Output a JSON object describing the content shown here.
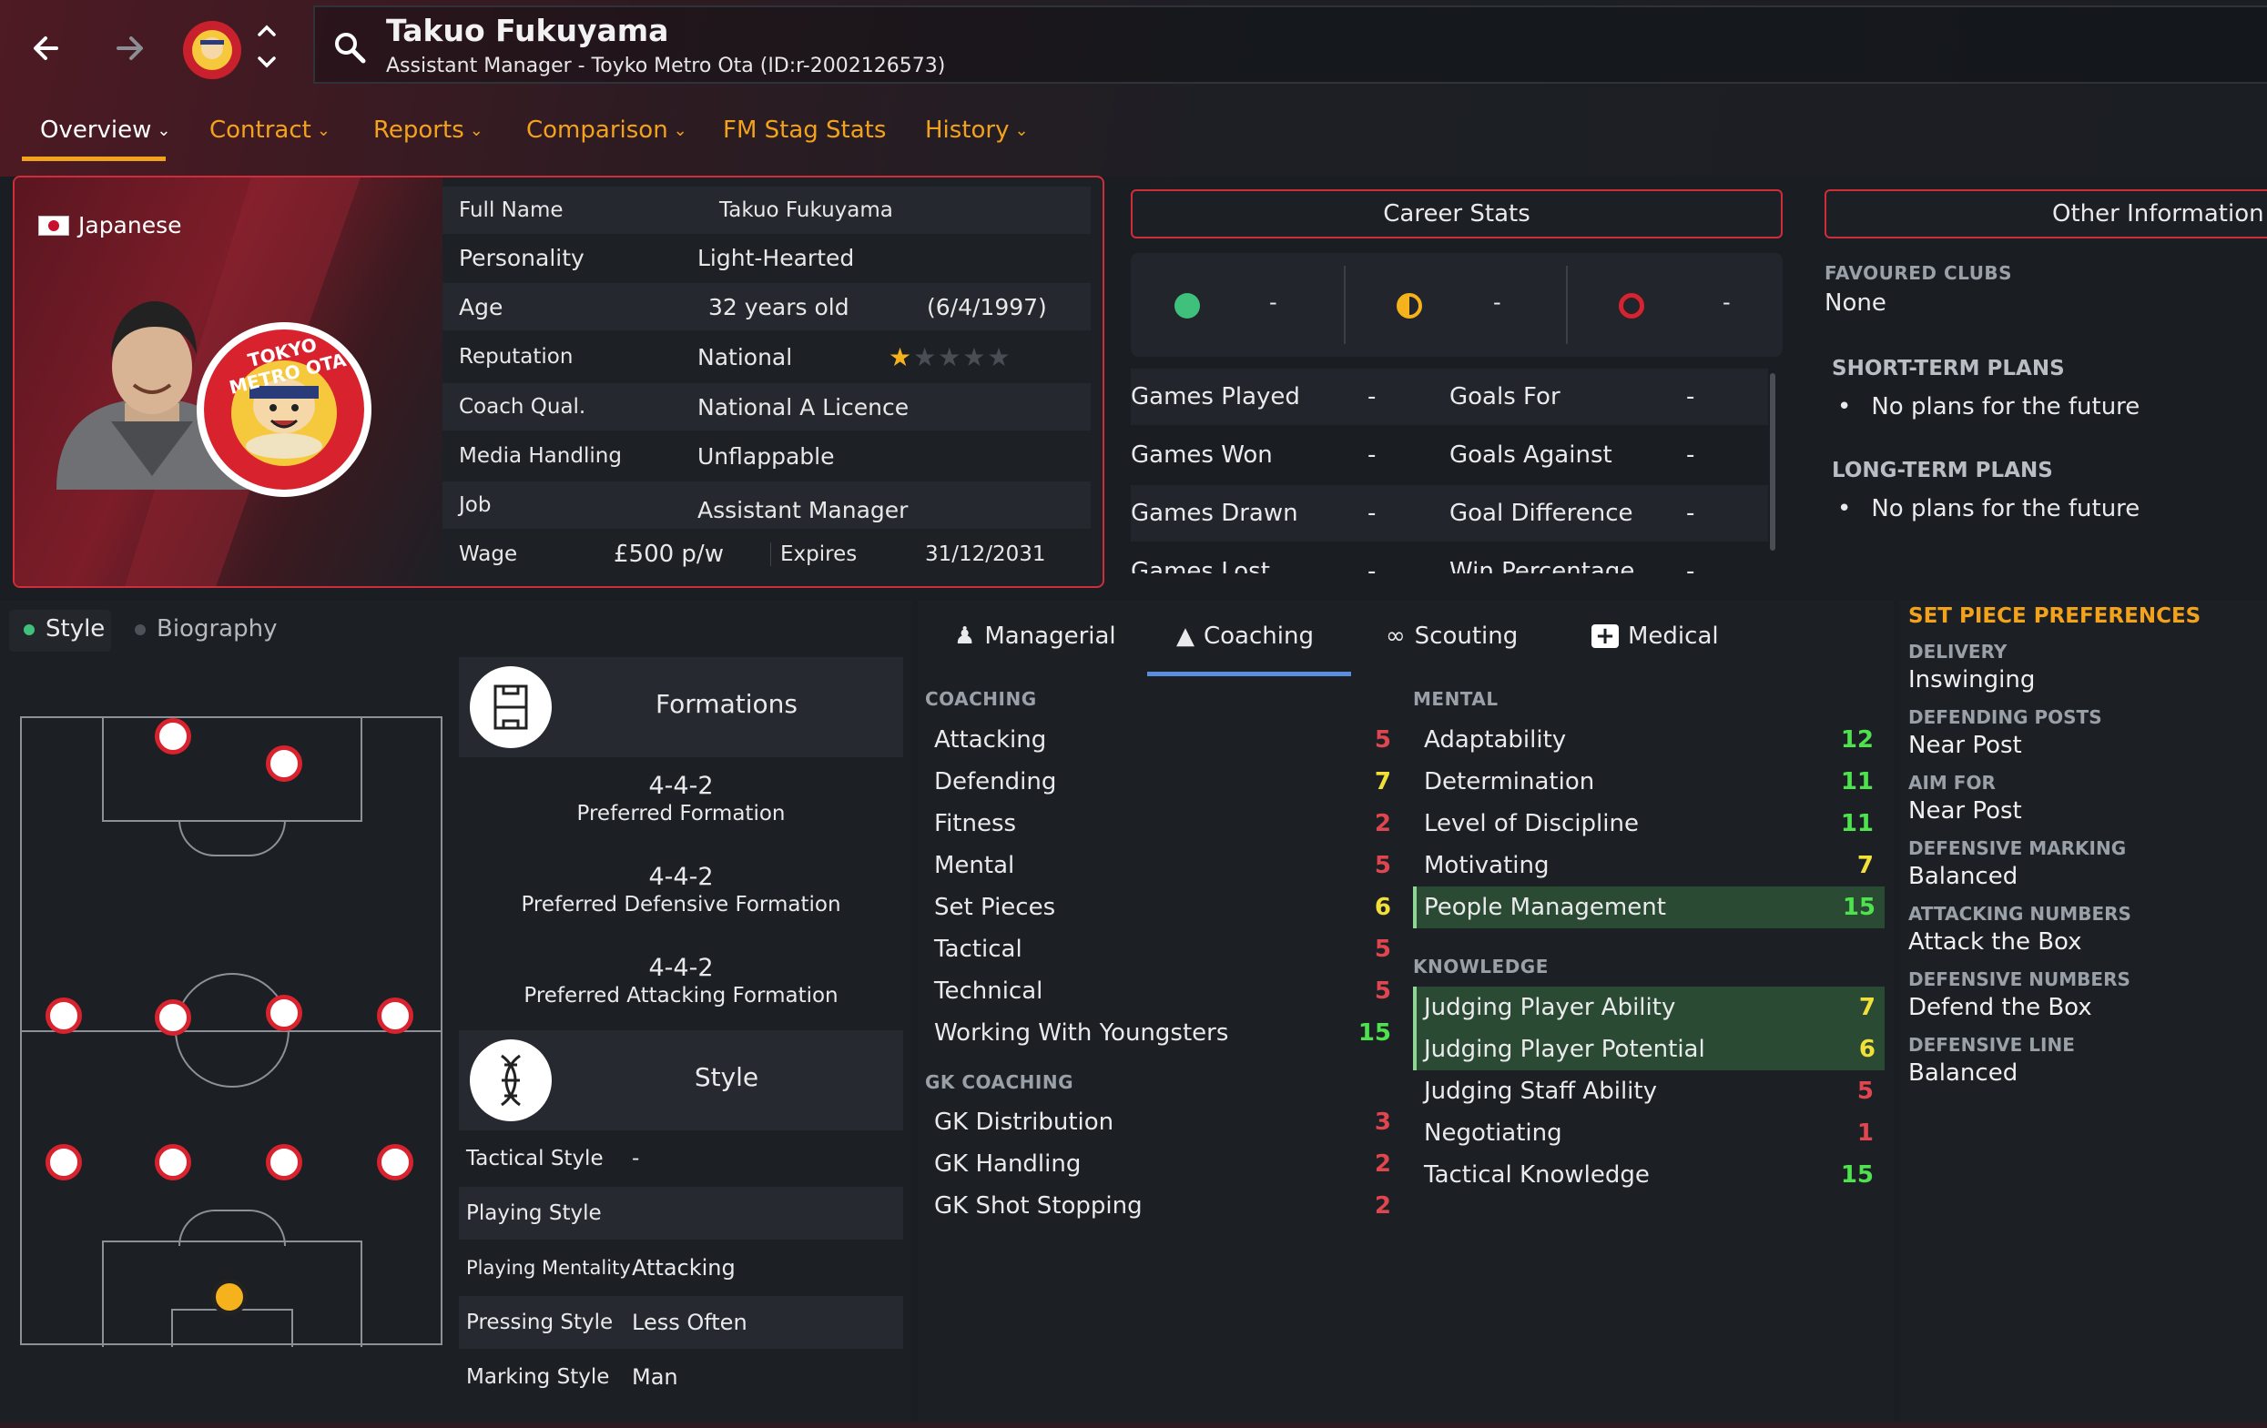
{
  "header": {
    "name": "Takuo Fukuyama",
    "subtitle": "Assistant Manager - Toyko Metro Ota (ID:r-2002126573)",
    "tabs": [
      {
        "label": "Overview",
        "chevron": true
      },
      {
        "label": "Contract",
        "chevron": true
      },
      {
        "label": "Reports",
        "chevron": true
      },
      {
        "label": "Comparison",
        "chevron": true
      },
      {
        "label": "FM Stag Stats",
        "chevron": false
      },
      {
        "label": "History",
        "chevron": true
      }
    ],
    "accent": "#f3a21b"
  },
  "profile": {
    "nationality": "Japanese",
    "badge_text": "TOKYO METRO OTA",
    "rows": [
      {
        "label": "Full Name",
        "value": "Takuo Fukuyama"
      },
      {
        "label": "Personality",
        "value": "Light-Hearted"
      },
      {
        "label": "Age",
        "value": "32 years old",
        "extra": "(6/4/1997)"
      },
      {
        "label": "Reputation",
        "value": "National",
        "stars": 1,
        "stars_max": 5
      },
      {
        "label": "Coach Qual.",
        "value": "National A Licence"
      },
      {
        "label": "Media Handling",
        "value": "Unflappable"
      },
      {
        "label": "Job",
        "value": "Assistant Manager"
      },
      {
        "label": "Wage",
        "value": "£500 p/w",
        "expires_label": "Expires",
        "expires": "31/12/2031"
      }
    ]
  },
  "career": {
    "title": "Career Stats",
    "summary": [
      "-",
      "-",
      "-"
    ],
    "rows": [
      {
        "l1": "Games Played",
        "v1": "-",
        "l2": "Goals For",
        "v2": "-"
      },
      {
        "l1": "Games Won",
        "v1": "-",
        "l2": "Goals Against",
        "v2": "-"
      },
      {
        "l1": "Games Drawn",
        "v1": "-",
        "l2": "Goal Difference",
        "v2": "-"
      },
      {
        "l1": "Games Lost",
        "v1": "-",
        "l2": "Win Percentage",
        "v2": "-"
      }
    ]
  },
  "other": {
    "title": "Other Information",
    "favoured_label": "FAVOURED CLUBS",
    "favoured_value": "None",
    "short_label": "SHORT-TERM PLANS",
    "short_value": "No plans for the future",
    "long_label": "LONG-TERM PLANS",
    "long_value": "No plans for the future"
  },
  "style_tabs": {
    "style": "Style",
    "biography": "Biography"
  },
  "formations": {
    "title": "Formations",
    "items": [
      {
        "value": "4-4-2",
        "label": "Preferred Formation"
      },
      {
        "value": "4-4-2",
        "label": "Preferred Defensive Formation"
      },
      {
        "value": "4-4-2",
        "label": "Preferred Attacking Formation"
      }
    ]
  },
  "style": {
    "title": "Style",
    "rows": [
      {
        "label": "Tactical Style",
        "value": "-"
      },
      {
        "label": "Playing Style",
        "value": ""
      },
      {
        "label": "Playing Mentality",
        "value": "Attacking"
      },
      {
        "label": "Pressing Style",
        "value": "Less Often"
      },
      {
        "label": "Marking Style",
        "value": "Man"
      }
    ]
  },
  "attr_tabs": [
    "Managerial",
    "Coaching",
    "Scouting",
    "Medical"
  ],
  "coaching": {
    "label": "COACHING",
    "items": [
      {
        "name": "Attacking",
        "value": 5
      },
      {
        "name": "Defending",
        "value": 7
      },
      {
        "name": "Fitness",
        "value": 2
      },
      {
        "name": "Mental",
        "value": 5
      },
      {
        "name": "Set Pieces",
        "value": 6
      },
      {
        "name": "Tactical",
        "value": 5
      },
      {
        "name": "Technical",
        "value": 5
      },
      {
        "name": "Working With Youngsters",
        "value": 15
      }
    ]
  },
  "gk": {
    "label": "GK COACHING",
    "items": [
      {
        "name": "GK Distribution",
        "value": 3
      },
      {
        "name": "GK Handling",
        "value": 2
      },
      {
        "name": "GK Shot Stopping",
        "value": 2
      }
    ]
  },
  "mental": {
    "label": "MENTAL",
    "items": [
      {
        "name": "Adaptability",
        "value": 12
      },
      {
        "name": "Determination",
        "value": 11
      },
      {
        "name": "Level of Discipline",
        "value": 11
      },
      {
        "name": "Motivating",
        "value": 7
      },
      {
        "name": "People Management",
        "value": 15,
        "highlight": true
      }
    ]
  },
  "knowledge": {
    "label": "KNOWLEDGE",
    "items": [
      {
        "name": "Judging Player Ability",
        "value": 7,
        "highlight": true
      },
      {
        "name": "Judging Player Potential",
        "value": 6,
        "highlight": true
      },
      {
        "name": "Judging Staff Ability",
        "value": 5
      },
      {
        "name": "Negotiating",
        "value": 1
      },
      {
        "name": "Tactical Knowledge",
        "value": 15
      }
    ]
  },
  "set_piece": {
    "title": "SET PIECE PREFERENCES",
    "items": [
      {
        "label": "DELIVERY",
        "value": "Inswinging"
      },
      {
        "label": "DEFENDING POSTS",
        "value": "Near Post"
      },
      {
        "label": "AIM FOR",
        "value": "Near Post"
      },
      {
        "label": "DEFENSIVE MARKING",
        "value": "Balanced"
      },
      {
        "label": "ATTACKING NUMBERS",
        "value": "Attack the Box"
      },
      {
        "label": "DEFENSIVE NUMBERS",
        "value": "Defend the Box"
      },
      {
        "label": "DEFENSIVE LINE",
        "value": "Balanced"
      }
    ]
  }
}
